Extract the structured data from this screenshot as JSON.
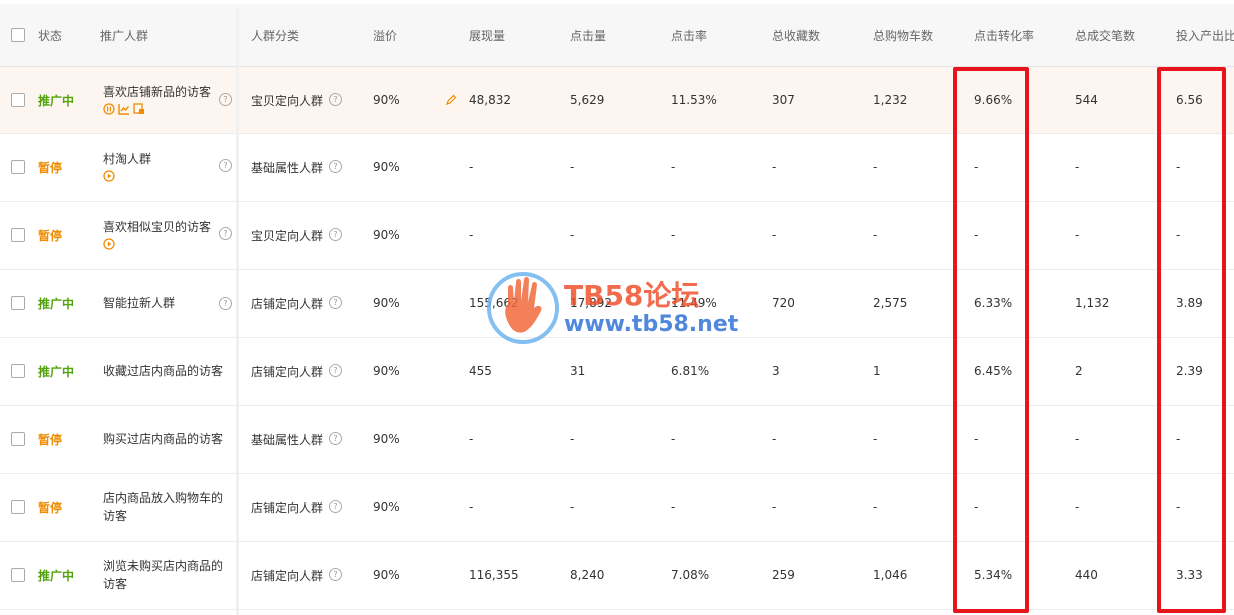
{
  "header": {
    "status": "状态",
    "crowd": "推广人群",
    "category": "人群分类",
    "premium": "溢价",
    "impressions": "展现量",
    "clicks": "点击量",
    "ctr": "点击率",
    "favorites": "总收藏数",
    "cart": "总购物车数",
    "conversion": "点击转化率",
    "orders": "总成交笔数",
    "roi": "投入产出比"
  },
  "rows": [
    {
      "status": "推广中",
      "status_type": "active",
      "name": "喜欢店铺新品的访客",
      "category": "宝贝定向人群",
      "premium": "90%",
      "impressions": "48,832",
      "clicks": "5,629",
      "ctr": "11.53%",
      "favorites": "307",
      "cart": "1,232",
      "conversion": "9.66%",
      "orders": "544",
      "roi": "6.56"
    },
    {
      "status": "暂停",
      "status_type": "paused",
      "name": "村淘人群",
      "category": "基础属性人群",
      "premium": "90%",
      "impressions": "-",
      "clicks": "-",
      "ctr": "-",
      "favorites": "-",
      "cart": "-",
      "conversion": "-",
      "orders": "-",
      "roi": "-"
    },
    {
      "status": "暂停",
      "status_type": "paused",
      "name": "喜欢相似宝贝的访客",
      "category": "宝贝定向人群",
      "premium": "90%",
      "impressions": "-",
      "clicks": "-",
      "ctr": "-",
      "favorites": "-",
      "cart": "-",
      "conversion": "-",
      "orders": "-",
      "roi": "-"
    },
    {
      "status": "推广中",
      "status_type": "active",
      "name": "智能拉新人群",
      "category": "店铺定向人群",
      "premium": "90%",
      "impressions": "155,662",
      "clicks": "17,892",
      "ctr": "11.49%",
      "favorites": "720",
      "cart": "2,575",
      "conversion": "6.33%",
      "orders": "1,132",
      "roi": "3.89"
    },
    {
      "status": "推广中",
      "status_type": "active",
      "name": "收藏过店内商品的访客",
      "category": "店铺定向人群",
      "premium": "90%",
      "impressions": "455",
      "clicks": "31",
      "ctr": "6.81%",
      "favorites": "3",
      "cart": "1",
      "conversion": "6.45%",
      "orders": "2",
      "roi": "2.39"
    },
    {
      "status": "暂停",
      "status_type": "paused",
      "name": "购买过店内商品的访客",
      "category": "基础属性人群",
      "premium": "90%",
      "impressions": "-",
      "clicks": "-",
      "ctr": "-",
      "favorites": "-",
      "cart": "-",
      "conversion": "-",
      "orders": "-",
      "roi": "-"
    },
    {
      "status": "暂停",
      "status_type": "paused",
      "name": "店内商品放入购物车的",
      "name2": "访客",
      "category": "店铺定向人群",
      "premium": "90%",
      "impressions": "-",
      "clicks": "-",
      "ctr": "-",
      "favorites": "-",
      "cart": "-",
      "conversion": "-",
      "orders": "-",
      "roi": "-"
    },
    {
      "status": "推广中",
      "status_type": "active",
      "name": "浏览未购买店内商品的",
      "name2": "访客",
      "category": "店铺定向人群",
      "premium": "90%",
      "impressions": "116,355",
      "clicks": "8,240",
      "ctr": "7.08%",
      "favorites": "259",
      "cart": "1,046",
      "conversion": "5.34%",
      "orders": "440",
      "roi": "3.33"
    }
  ],
  "icons": {
    "help": "question-circle-icon",
    "edit": "pencil-icon",
    "pause": "pause-circle-icon",
    "trend": "trend-chart-icon",
    "report": "report-icon",
    "play": "play-circle-icon"
  },
  "colors": {
    "active": "#52a30c",
    "paused": "#f08c00",
    "highlight_box": "#e8141c",
    "icon_orange": "#f08c00"
  },
  "watermark": {
    "title": "TB58论坛",
    "url": "www.tb58.net"
  }
}
